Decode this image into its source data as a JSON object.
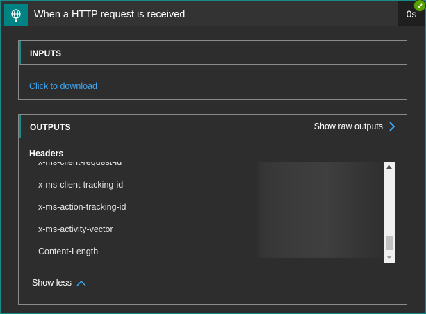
{
  "card": {
    "title": "When a HTTP request is received",
    "duration": "0s",
    "status_icon": "check-icon",
    "trigger_icon": "globe-request-icon"
  },
  "inputs": {
    "title": "INPUTS",
    "download_link": "Click to download"
  },
  "outputs": {
    "title": "OUTPUTS",
    "raw_outputs_label": "Show raw outputs",
    "headers_label": "Headers",
    "header_rows": [
      "x-ms-client-request-id",
      "x-ms-client-tracking-id",
      "x-ms-action-tracking-id",
      "x-ms-activity-vector",
      "Content-Length"
    ],
    "show_less_label": "Show less"
  },
  "colors": {
    "accent": "#1b8a8a",
    "icon_bg": "#008383",
    "link": "#3fa9f5",
    "success": "#57a300",
    "background": "#2d2d2d"
  }
}
